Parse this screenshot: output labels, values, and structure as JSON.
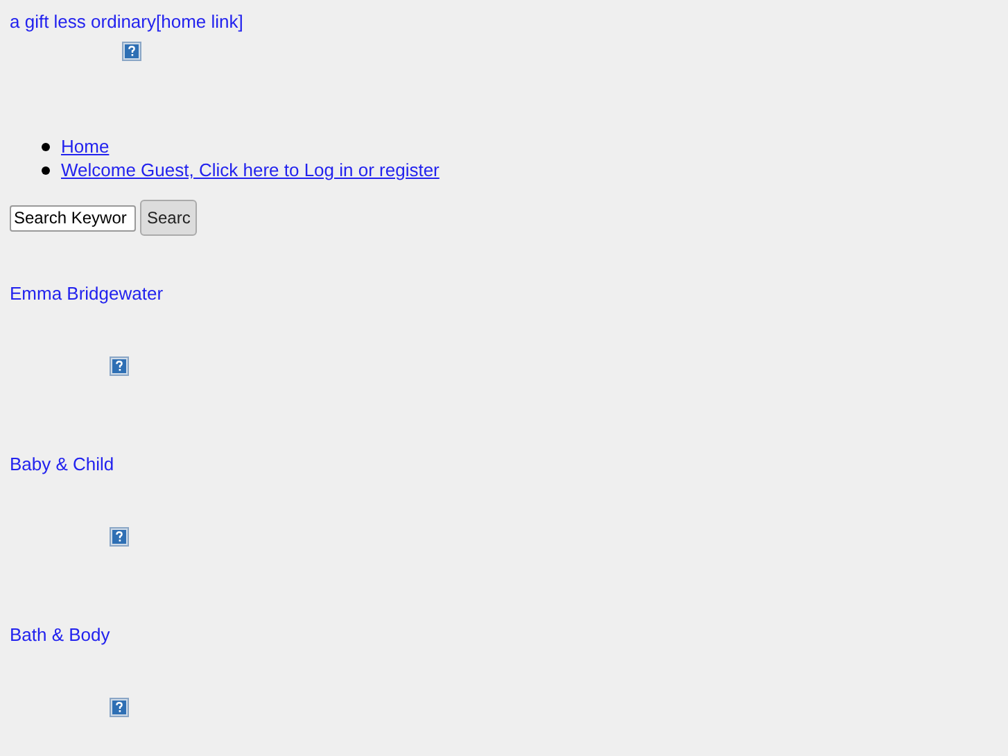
{
  "header": {
    "logo_link": "a gift less ordinary[home link]",
    "logo_image": {
      "kind": "broken-image"
    }
  },
  "nav": [
    {
      "label": "Home"
    },
    {
      "label": "Welcome Guest, Click here to Log in or register"
    }
  ],
  "search": {
    "value": "Search Keywor",
    "button": "Searc"
  },
  "categories": [
    {
      "label": "Emma Bridgewater"
    },
    {
      "label": "Baby & Child"
    },
    {
      "label": "Bath & Body"
    }
  ]
}
